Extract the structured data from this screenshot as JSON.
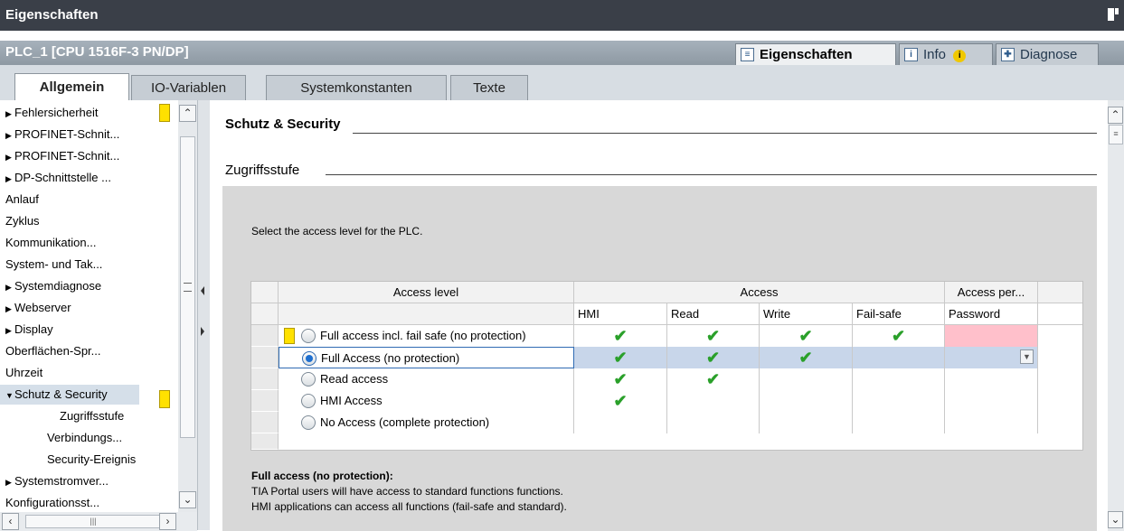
{
  "window": {
    "title": "Eigenschaften"
  },
  "device": {
    "name": "PLC_1 [CPU 1516F-3 PN/DP]"
  },
  "right_tabs": [
    {
      "label": "Eigenschaften"
    },
    {
      "label": "Info"
    },
    {
      "label": "Diagnose"
    }
  ],
  "main_tabs": [
    "Allgemein",
    "IO-Variablen",
    "Systemkonstanten",
    "Texte"
  ],
  "nav": [
    {
      "label": "Fehlersicherheit",
      "tri": "▶"
    },
    {
      "label": "PROFINET-Schnit...",
      "tri": "▶"
    },
    {
      "label": "PROFINET-Schnit...",
      "tri": "▶"
    },
    {
      "label": "DP-Schnittstelle ...",
      "tri": "▶"
    },
    {
      "label": "Anlauf",
      "tri": ""
    },
    {
      "label": "Zyklus",
      "tri": ""
    },
    {
      "label": "Kommunikation...",
      "tri": ""
    },
    {
      "label": "System- und Tak...",
      "tri": ""
    },
    {
      "label": "Systemdiagnose",
      "tri": "▶"
    },
    {
      "label": "Webserver",
      "tri": "▶"
    },
    {
      "label": "Display",
      "tri": "▶"
    },
    {
      "label": "Oberflächen-Spr...",
      "tri": ""
    },
    {
      "label": "Uhrzeit",
      "tri": ""
    },
    {
      "label": "Schutz & Security",
      "tri": "▼"
    },
    {
      "label": "Zugriffsstufe",
      "tri": ""
    },
    {
      "label": "Verbindungs...",
      "tri": ""
    },
    {
      "label": "Security-Ereignis",
      "tri": ""
    },
    {
      "label": "Systemstromver...",
      "tri": "▶"
    },
    {
      "label": "Konfigurationsst...",
      "tri": ""
    }
  ],
  "section": {
    "title": "Schutz & Security",
    "subtitle": "Zugriffsstufe"
  },
  "instruction": "Select the access level for the PLC.",
  "table": {
    "col_access_level": "Access level",
    "col_access": "Access",
    "col_access_per": "Access per...",
    "sub_headers": [
      "HMI",
      "Read",
      "Write",
      "Fail-safe",
      "Password"
    ],
    "check": "✔",
    "rows": [
      {
        "label": "Full access incl. fail safe (no protection)",
        "hmi": true,
        "read": true,
        "write": true,
        "failsafe": true,
        "selected": false
      },
      {
        "label": "Full Access (no protection)",
        "hmi": true,
        "read": true,
        "write": true,
        "failsafe": false,
        "selected": true
      },
      {
        "label": "Read access",
        "hmi": true,
        "read": true,
        "write": false,
        "failsafe": false,
        "selected": false
      },
      {
        "label": "HMI Access",
        "hmi": true,
        "read": false,
        "write": false,
        "failsafe": false,
        "selected": false
      },
      {
        "label": "No Access (complete protection)",
        "hmi": false,
        "read": false,
        "write": false,
        "failsafe": false,
        "selected": false
      }
    ]
  },
  "description": {
    "title": "Full access (no protection):",
    "line1": "TIA Portal users will have access to standard functions functions.",
    "line2": "HMI applications can access all functions (fail-safe and standard)."
  },
  "colors": {
    "title_bg": "#3a3f48",
    "check": "#2aa02a",
    "highlight_row": "#c8d6ea",
    "password_pink": "#ffc0cb",
    "marker_yellow": "#ffe100"
  }
}
